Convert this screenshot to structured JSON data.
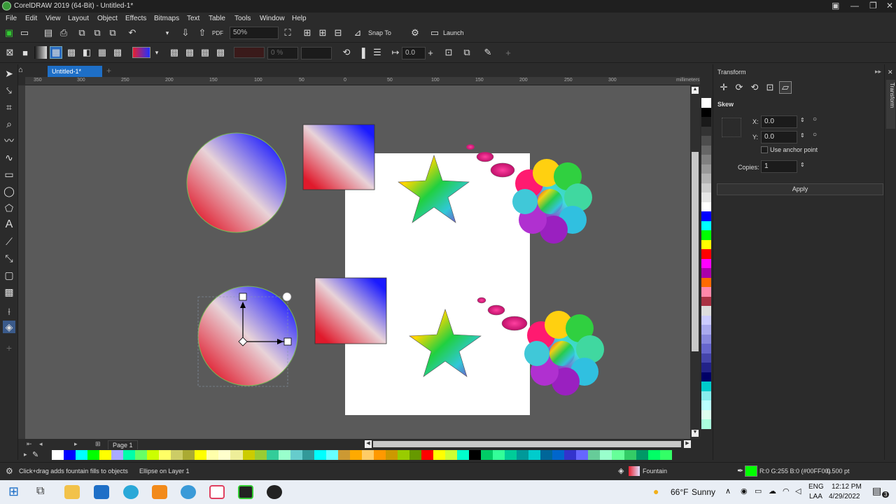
{
  "window": {
    "title": "CorelDRAW 2019 (64-Bit) - Untitled-1*"
  },
  "menu": [
    "File",
    "Edit",
    "View",
    "Layout",
    "Object",
    "Effects",
    "Bitmaps",
    "Text",
    "Table",
    "Tools",
    "Window",
    "Help"
  ],
  "toolbar": {
    "zoom": "50%",
    "snap_label": "Snap To",
    "launch_label": "Launch"
  },
  "property_bar": {
    "transparency_value": "0 %",
    "offset_value": "0.0"
  },
  "document": {
    "tab": "Untitled-1*",
    "page_tab": "Page 1",
    "ruler_unit": "millimeters",
    "ruler_ticks": [
      "350",
      "300",
      "250",
      "200",
      "150",
      "100",
      "50",
      "0",
      "50",
      "100",
      "150",
      "200",
      "250",
      "300"
    ]
  },
  "docker": {
    "title": "Transform",
    "section": "Skew",
    "x_label": "X:",
    "x_value": "0.0",
    "y_label": "Y:",
    "y_value": "0.0",
    "anchor_label": "Use anchor point",
    "copies_label": "Copies:",
    "copies_value": "1",
    "apply_label": "Apply",
    "side_tab": "Transform"
  },
  "status": {
    "hint": "Click+drag adds fountain fills to objects",
    "selection": "Ellipse on Layer 1",
    "fill_label": "Fountain",
    "outline_color": "R:0 G:255 B:0 (#00FF00)",
    "outline_width": "0.500 pt",
    "outline_swatch": "#00ff00"
  },
  "taskbar": {
    "weather_temp": "66°F",
    "weather_desc": "Sunny",
    "lang": "ENG",
    "lang_sub": "LAA",
    "time": "12:12 PM",
    "date": "4/29/2022",
    "notif": "3"
  },
  "palette_vertical": [
    "#ffffff",
    "#000000",
    "#1a1a1a",
    "#333333",
    "#4d4d4d",
    "#666666",
    "#808080",
    "#999999",
    "#b3b3b3",
    "#cccccc",
    "#e6e6e6",
    "#ffffff",
    "#0000ff",
    "#00ffff",
    "#00ff00",
    "#ffff00",
    "#ff0000",
    "#ff00ff",
    "#aa00aa",
    "#ff6a00",
    "#ff88aa",
    "#aa3344",
    "#dddddd",
    "#ccccff",
    "#aaaaee",
    "#8888dd",
    "#6666cc",
    "#4444aa",
    "#222288",
    "#000066",
    "#00cccc",
    "#88eeee",
    "#bbffff",
    "#ddffee",
    "#aaffdd"
  ],
  "palette_horizontal": [
    "#ffffff",
    "#0000ff",
    "#00ffff",
    "#00ff00",
    "#ffff00",
    "#aaaaff",
    "#00ffaa",
    "#66ff66",
    "#ccff00",
    "#ffff66",
    "#cccc66",
    "#aaaa33",
    "#ffff00",
    "#ffffaa",
    "#ffffcc",
    "#eeee99",
    "#cccc00",
    "#99cc33",
    "#33cc99",
    "#99ffcc",
    "#66cccc",
    "#339999",
    "#00ffff",
    "#66ffff",
    "#cc9933",
    "#ffaa00",
    "#ffcc66",
    "#ff9900",
    "#cc9900",
    "#99cc00",
    "#669900",
    "#ff0000",
    "#ffff00",
    "#ccff33",
    "#00ffcc",
    "#000000",
    "#00cc66",
    "#33ff99",
    "#00cc99",
    "#009999",
    "#00cccc",
    "#006699",
    "#0066cc",
    "#3333cc",
    "#6666ff",
    "#66cc99",
    "#99ffcc",
    "#66ff99",
    "#33cc66",
    "#009966",
    "#00ff66",
    "#33ff66"
  ],
  "colors": {
    "accent": "#1e6fc7"
  }
}
